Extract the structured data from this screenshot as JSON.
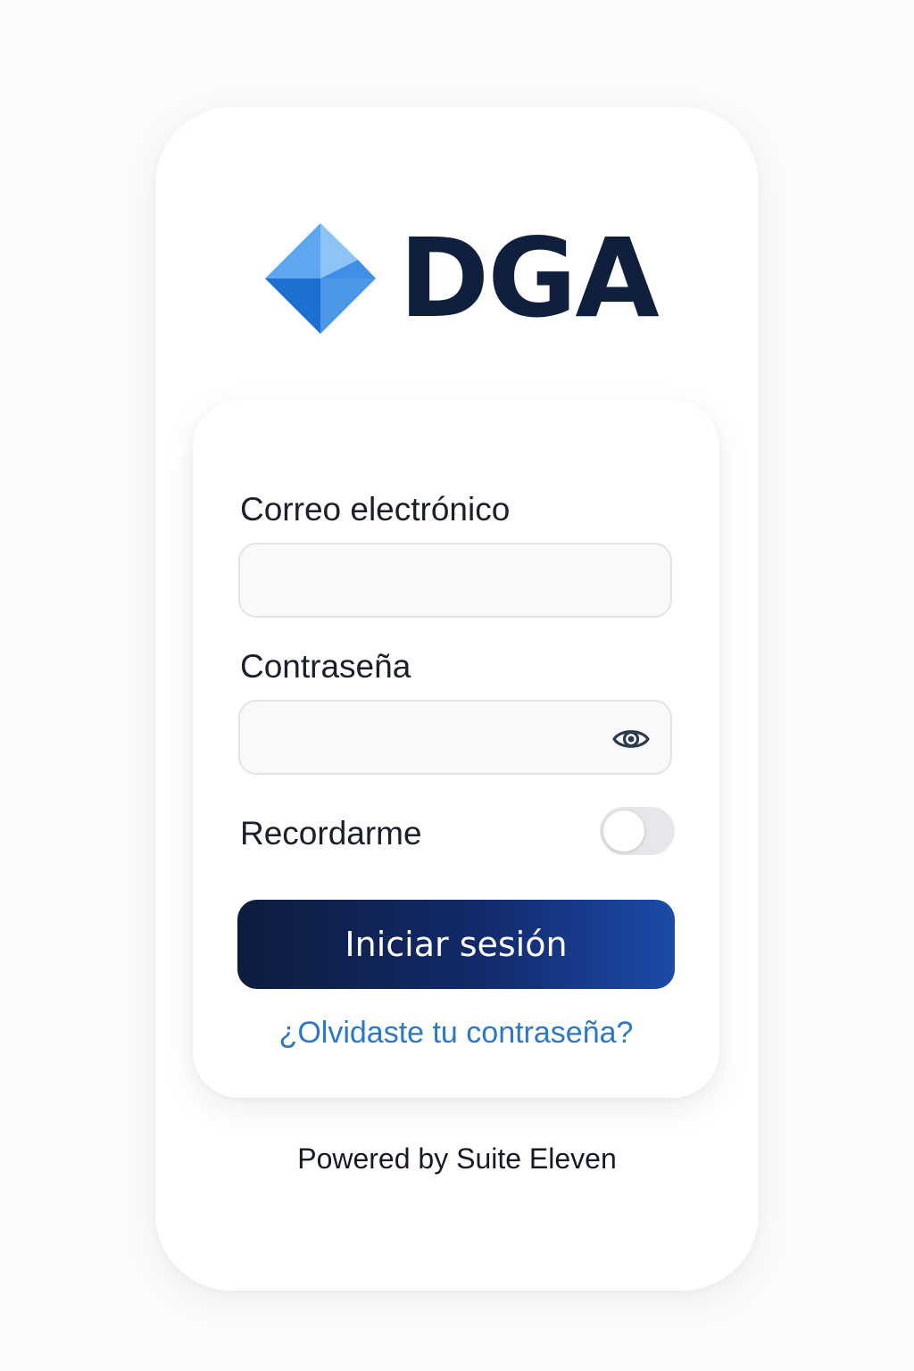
{
  "brand": {
    "name": "DGA",
    "mark_icon": "blue-diamond-logo-icon",
    "colors": {
      "text": "#0f1f3d",
      "mark_light": "#8ec3f5",
      "mark_mid": "#4b98e8",
      "mark_dark": "#1f6fd0"
    }
  },
  "form": {
    "email": {
      "label": "Correo electrónico",
      "value": "",
      "placeholder": ""
    },
    "password": {
      "label": "Contraseña",
      "value": "",
      "placeholder": "",
      "toggle_icon": "eye-icon"
    },
    "remember": {
      "label": "Recordarme",
      "enabled": false
    },
    "submit_label": "Iniciar sesión",
    "forgot_link": "¿Olvidaste tu contraseña?"
  },
  "footer": {
    "powered_by": "Powered by Suite Eleven"
  },
  "colors": {
    "button_gradient_start": "#0e1c3e",
    "button_gradient_end": "#1b4aa8",
    "link": "#2a78c8",
    "toggle_off": "#e5e7ea"
  }
}
